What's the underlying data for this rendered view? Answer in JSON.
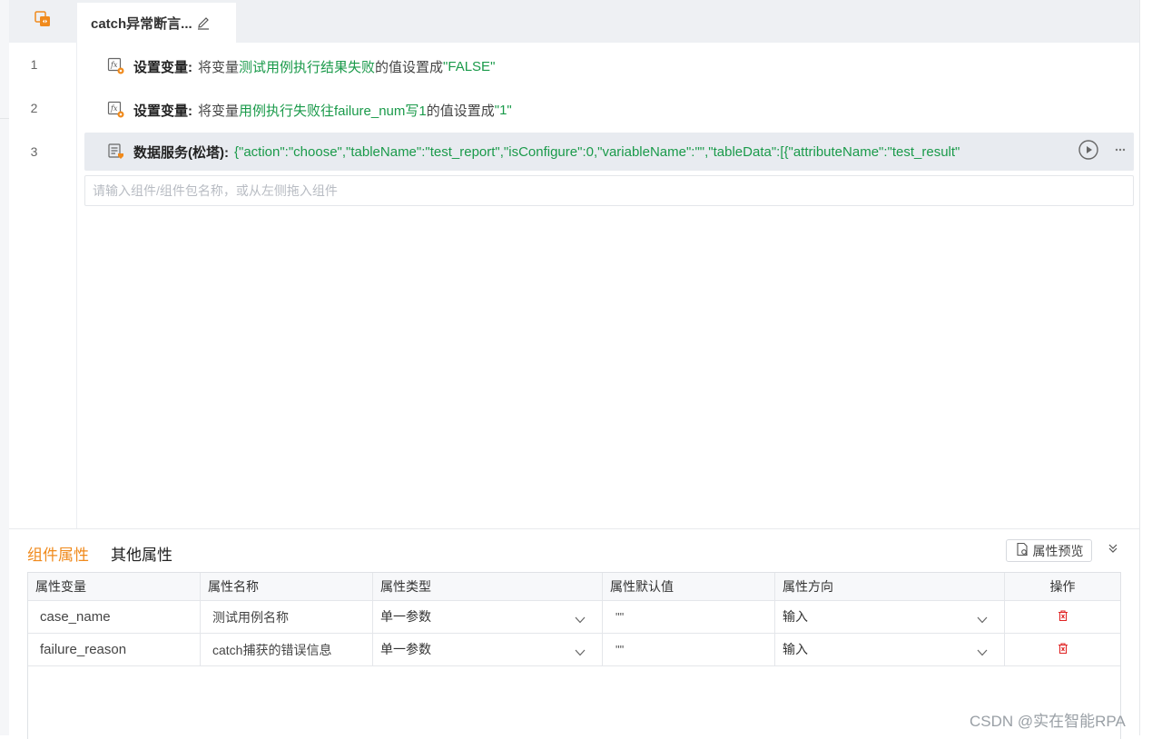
{
  "tab": {
    "title": "catch异常断言..."
  },
  "lines": [
    {
      "number": "1",
      "title": "设置变量:",
      "prefix": "将变量",
      "variable": "测试用例执行结果失败",
      "middle": "的值设置成",
      "value": "\"FALSE\""
    },
    {
      "number": "2",
      "title": "设置变量:",
      "prefix": "将变量",
      "variable": "用例执行失败往failure_num写1",
      "middle": "的值设置成",
      "value": "\"1\""
    },
    {
      "number": "3",
      "title": "数据服务(松塔):",
      "json": "{\"action\":\"choose\",\"tableName\":\"test_report\",\"isConfigure\":0,\"variableName\":\"\",\"tableData\":[{\"attributeName\":\"test_result\""
    }
  ],
  "editor": {
    "placeholder": "请输入组件/组件包名称，或从左侧拖入组件"
  },
  "properties": {
    "tabs": [
      "组件属性",
      "其他属性"
    ],
    "preview_label": "属性预览",
    "columns": [
      "属性变量",
      "属性名称",
      "属性类型",
      "属性默认值",
      "属性方向",
      "操作"
    ],
    "rows": [
      {
        "variable": "case_name",
        "name": "测试用例名称",
        "type": "单一参数",
        "default": "\"\"",
        "direction": "输入"
      },
      {
        "variable": "failure_reason",
        "name": "catch捕获的错误信息",
        "type": "单一参数",
        "default": "\"\"",
        "direction": "输入"
      }
    ]
  },
  "watermark": "CSDN @实在智能RPA",
  "colors": {
    "accent": "#f08a1c",
    "green_text": "#1a9a4a",
    "delete_red": "#e02424"
  }
}
